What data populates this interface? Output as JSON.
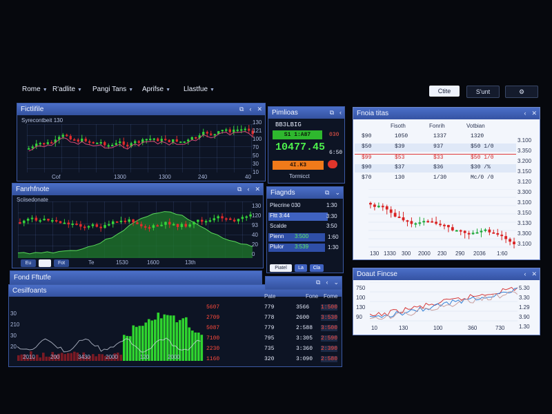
{
  "nav": {
    "items": [
      "Rome",
      "R'adlite",
      "Pangi Tans",
      "Aprifse",
      "Llastfue"
    ],
    "btn_light": "Ctite",
    "btn_dark": "S'unt",
    "gear": "⚙"
  },
  "panel_top": {
    "title": "Fictlifile",
    "subtitle": "Syrecontbeit 130",
    "y_ticks": [
      "130",
      "121",
      "100",
      "70",
      "50",
      "30",
      "10"
    ],
    "x_ticks": [
      "Cof",
      "1300",
      "1300",
      "240",
      "40"
    ]
  },
  "panel_mid": {
    "title": "Fanrhfnote",
    "subtitle": "Sciisedonate",
    "y_ticks": [
      "130",
      "120",
      "93",
      "40",
      "20",
      "0"
    ],
    "x_ticks": [
      "Te",
      "1530",
      "1600",
      "13th"
    ],
    "buttons": [
      "Eu",
      "",
      "Fot"
    ]
  },
  "panel_fund": {
    "title": "Fond Fftutfe"
  },
  "panel_bottom": {
    "title": "Cesilfoants",
    "y_ticks": [
      "30",
      "210",
      "30",
      "20"
    ],
    "x_ticks": [
      "2010",
      "200",
      "3430",
      "2000",
      "120",
      "2000"
    ],
    "table_headers": [
      "Pate",
      "Fone",
      "Fome"
    ],
    "rows": [
      [
        "5607",
        "779",
        "3566",
        "1:500"
      ],
      [
        "2709",
        "778",
        "2600",
        "3:530"
      ],
      [
        "5087",
        "779",
        "2:588",
        "3:500"
      ],
      [
        "7100",
        "795",
        "3:305",
        "2:590"
      ],
      [
        "2230",
        "735",
        "3:360",
        "2:390"
      ],
      [
        "1160",
        "320",
        "3:090",
        "2:580"
      ]
    ]
  },
  "quote": {
    "title": "Pimlioas",
    "header_price": "BB3LBIG",
    "chip_green": "S1 1:A87",
    "chip_side": "030",
    "big_price": "10477.45",
    "side_val": "6:50",
    "chip_orange": "4I.K3",
    "footer": "Tormicct"
  },
  "orders": {
    "title": "Fiagnds",
    "rows": [
      [
        "Plecrine 030",
        "1:30"
      ],
      [
        "Fltt 3:44",
        "3:30"
      ],
      [
        "Scalde",
        "3:50"
      ],
      [
        "Pienn",
        "3:500",
        "1:60"
      ],
      [
        "Plulor",
        "3:539",
        "1:30"
      ]
    ],
    "buttons": [
      "Piatel",
      "La",
      "Cla"
    ]
  },
  "right_top": {
    "title": "Fnoia titas",
    "headers": [
      "Fisoth",
      "Fonrih",
      "Votbian"
    ],
    "rows": [
      [
        "$90",
        "1050",
        "1337",
        "1320"
      ],
      [
        "$50",
        "$39",
        "937",
        "$50 1/0"
      ],
      [
        "$99",
        "$53",
        "$33",
        "$50 1/0"
      ],
      [
        "$90",
        "$37",
        "$36",
        "$30 /%"
      ],
      [
        "$70",
        "130",
        "1/30",
        "Mc/0 /0"
      ]
    ],
    "y_ticks": [
      "3.100",
      "3.350",
      "3.200",
      "3.150",
      "3.120",
      "3.300",
      "3.100",
      "3.150",
      "3.130",
      "3.300",
      "3.100"
    ],
    "x_ticks": [
      "130",
      "1330",
      "300",
      "2000",
      "230",
      "290",
      "2036",
      "1:60"
    ]
  },
  "right_bottom": {
    "title": "Doaut Fincse",
    "y_left": [
      "750",
      "100",
      "130",
      "90"
    ],
    "y_right": [
      "5.30",
      "3.30",
      "1.29",
      "3.90",
      "1.30"
    ],
    "x_ticks": [
      "10",
      "130",
      "100",
      "360",
      "730"
    ]
  },
  "colors": {
    "panel_title": "#4b6fc8",
    "up": "#2ecc40",
    "down": "#e02424",
    "accent_orange": "#f07a1a",
    "background": "#06080d"
  }
}
